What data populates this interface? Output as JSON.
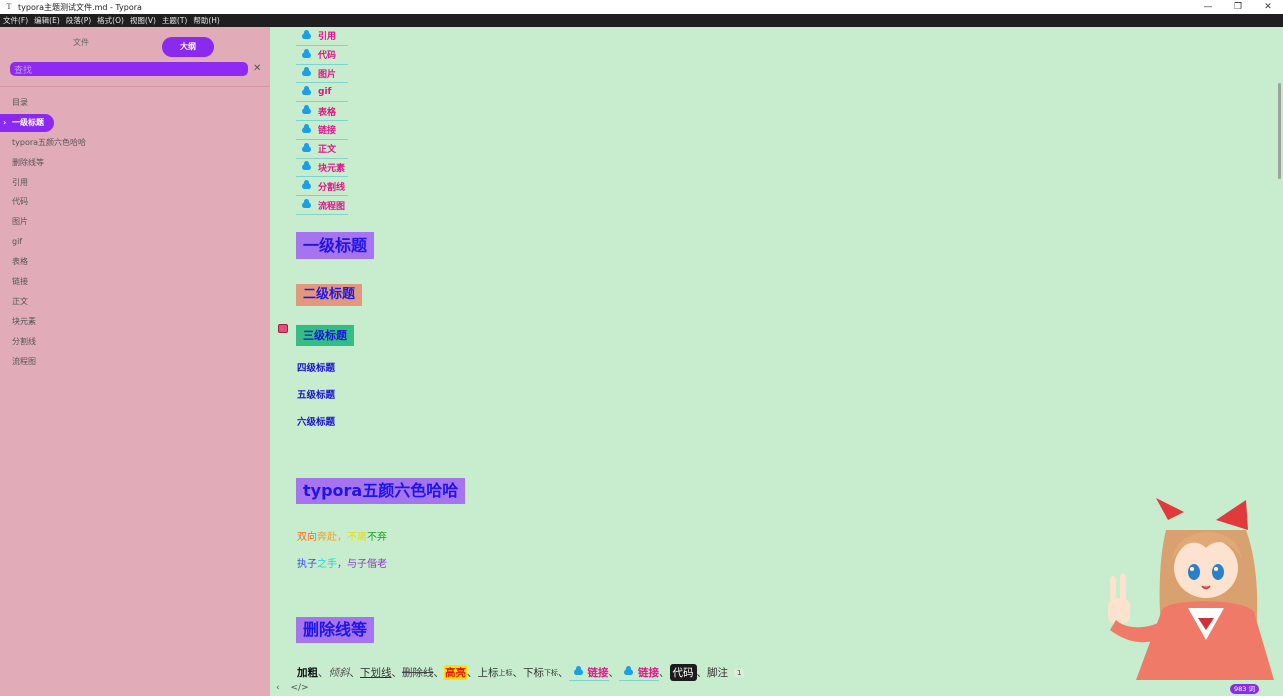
{
  "window": {
    "title": "typora主题测试文件.md - Typora",
    "app_icon": "T",
    "controls": {
      "minimize": "—",
      "restore": "❐",
      "close": "✕"
    }
  },
  "menu": [
    "文件(F)",
    "编辑(E)",
    "段落(P)",
    "格式(O)",
    "视图(V)",
    "主题(T)",
    "帮助(H)"
  ],
  "sidebar": {
    "tab_files": "文件",
    "tab_outline": "大纲",
    "search_placeholder": "查找",
    "search_close": "✕",
    "items": [
      {
        "label": "目录"
      },
      {
        "label": "一级标题",
        "active": true
      },
      {
        "label": "typora五颜六色哈哈"
      },
      {
        "label": "删除线等"
      },
      {
        "label": "引用"
      },
      {
        "label": "代码"
      },
      {
        "label": "图片"
      },
      {
        "label": "gif"
      },
      {
        "label": "表格"
      },
      {
        "label": "链接"
      },
      {
        "label": "正文"
      },
      {
        "label": "块元素"
      },
      {
        "label": "分割线"
      },
      {
        "label": "流程图"
      }
    ]
  },
  "editor": {
    "toc": [
      "引用",
      "代码",
      "图片",
      "gif",
      "表格",
      "链接",
      "正文",
      "块元素",
      "分割线",
      "流程图"
    ],
    "h1": "一级标题",
    "h2": "二级标题",
    "h3": "三级标题",
    "h4": "四级标题",
    "h5": "五级标题",
    "h6": "六级标题",
    "h1_colorful": "typora五颜六色哈哈",
    "poem_line1": [
      "双向",
      "奔赴",
      "，",
      "不离",
      "不弃"
    ],
    "poem_line2": [
      "执子",
      "之手",
      "，",
      "与子偕老"
    ],
    "h1_strike": "删除线等",
    "inline": {
      "bold": "加粗",
      "sep": "、",
      "italic": "倾斜",
      "underline": "下划线",
      "strike": "删除线",
      "highlight": "高亮",
      "sup_base": "上标",
      "sup": "上标",
      "sub_base": "下标",
      "sub": "下标",
      "link1": "链接",
      "link2": "链接",
      "code": "代码",
      "footnote": "脚注",
      "footnote_ref": "1"
    }
  },
  "status": {
    "back_icon": "‹",
    "source_icon": "</>",
    "word_count": "983 词"
  },
  "colors": {
    "accent": "#8a29f0",
    "sidebar_bg": "#e1acb8",
    "editor_bg": "#c8ecce",
    "link": "#e0158a"
  }
}
